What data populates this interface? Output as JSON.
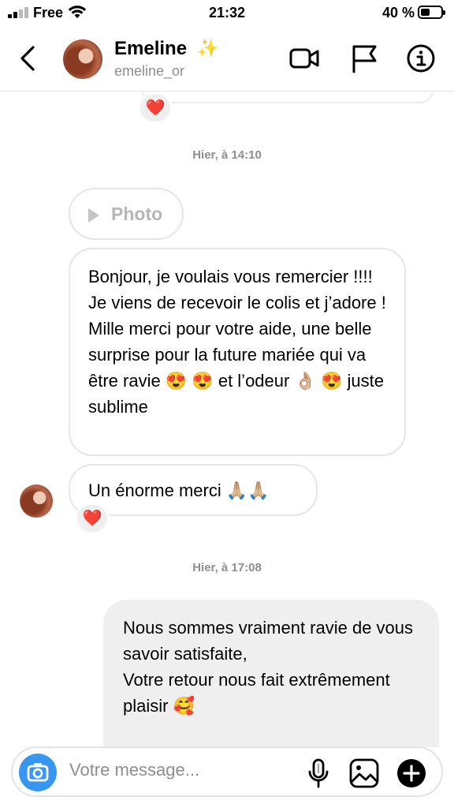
{
  "status_bar": {
    "carrier": "Free",
    "time": "21:32",
    "battery_percent": "40 %",
    "battery_level": 0.4,
    "signal_bars": 2
  },
  "header": {
    "contact_name": "Emeline",
    "contact_emoji": "✨",
    "contact_handle": "emeline_or",
    "icons": [
      "back-icon",
      "video-call-icon",
      "flag-icon",
      "info-icon"
    ]
  },
  "messages": {
    "top_reaction": "❤️",
    "timestamp_1": "Hier, à 14:10",
    "photo_label": "Photo",
    "incoming_1": {
      "para_1": "Bonjour, je voulais vous remercier !!!! Je viens de recevoir le colis et j’adore !",
      "para_2": "Mille merci pour votre aide, une belle surprise pour la future mariée qui va être ravie 😍 😍  et l’odeur 👌🏼 😍  juste sublime"
    },
    "incoming_2": "Un énorme merci 🙏🏼🙏🏼",
    "incoming_2_reaction": "❤️",
    "timestamp_2": "Hier, à 17:08",
    "outgoing_1": {
      "para_1": "Nous sommes vraiment ravie de vous savoir satisfaite,",
      "para_2": "Votre retour nous fait extrêmement plaisir 🥰"
    }
  },
  "composer": {
    "placeholder": "Votre message...",
    "accent_color": "#3797f0"
  }
}
